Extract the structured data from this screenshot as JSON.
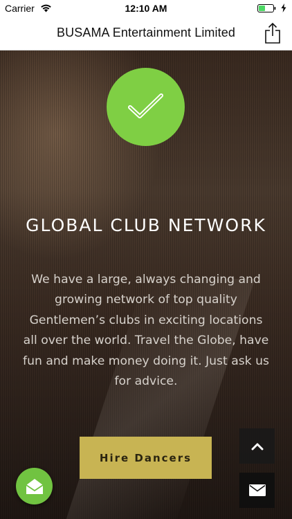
{
  "status_bar": {
    "carrier": "Carrier",
    "time": "12:10 AM",
    "wifi_icon": "wifi-icon",
    "battery_icon": "battery-icon",
    "battery_color": "#4cd964"
  },
  "nav": {
    "title": "BUSAMA Entertainment Limited",
    "share_icon": "share-icon"
  },
  "hero": {
    "badge_icon": "checkmark-icon",
    "badge_color": "#7fcf44",
    "title": "GLOBAL CLUB NETWORK",
    "body": "We have a large, always changing and growing network of top quality Gentlemen’s clubs in exciting locations all over the world. Travel the Globe, have fun and make money doing it. Just ask us for advice.",
    "cta_label": "Hire Dancers",
    "cta_color": "#c8b453"
  },
  "floating": {
    "scroll_top_icon": "chevron-up-icon",
    "email_icon": "envelope-icon",
    "fab_icon": "open-envelope-icon",
    "fab_color": "#71c341"
  }
}
